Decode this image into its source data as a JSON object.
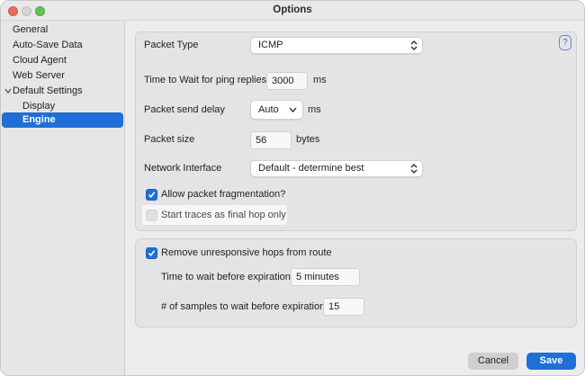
{
  "window": {
    "title": "Options"
  },
  "sidebar": {
    "items": [
      {
        "label": "General"
      },
      {
        "label": "Auto-Save Data"
      },
      {
        "label": "Cloud Agent"
      },
      {
        "label": "Web Server"
      },
      {
        "label": "Default Settings",
        "expanded": true
      },
      {
        "label": "Display"
      },
      {
        "label": "Engine",
        "selected": true
      }
    ]
  },
  "engine": {
    "help_label": "?",
    "packet_type": {
      "label": "Packet Type",
      "value": "ICMP"
    },
    "wait_ping": {
      "label": "Time to Wait for ping replies",
      "value": "3000",
      "unit": "ms"
    },
    "send_delay": {
      "label": "Packet send delay",
      "value": "Auto",
      "unit": "ms"
    },
    "packet_size": {
      "label": "Packet size",
      "value": "56",
      "unit": "bytes"
    },
    "network_interface": {
      "label": "Network Interface",
      "value": "Default - determine best"
    },
    "allow_fragmentation": {
      "label": "Allow packet fragmentation?",
      "checked": true
    },
    "final_hop": {
      "label": "Start traces as final hop only",
      "checked": false
    }
  },
  "hops": {
    "remove_unresponsive": {
      "label": "Remove unresponsive hops from route",
      "checked": true
    },
    "time_before_expiration": {
      "label": "Time to wait before expiration",
      "value": "5 minutes"
    },
    "samples_before_expiration": {
      "label": "# of samples to wait before expiration",
      "value": "15"
    }
  },
  "buttons": {
    "cancel": "Cancel",
    "save": "Save"
  },
  "colors": {
    "accent": "#1f6fd6",
    "window_bg": "#ececec",
    "group_bg": "#e4e4e4"
  }
}
